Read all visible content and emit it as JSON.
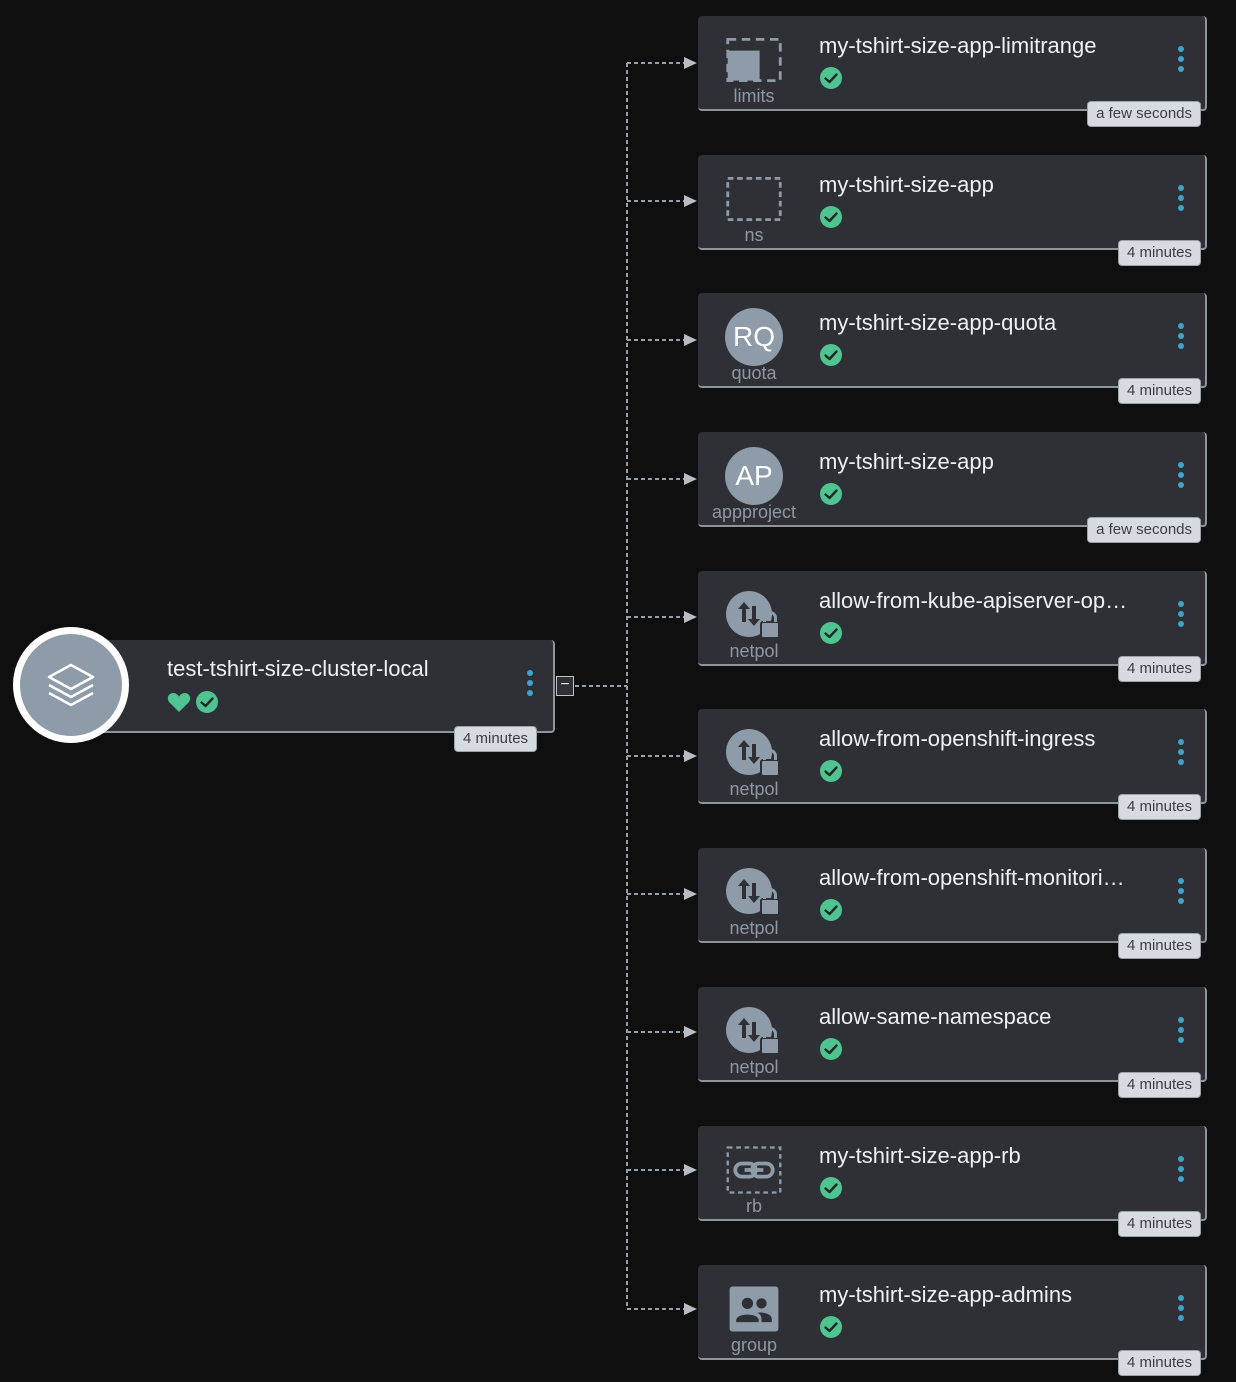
{
  "colors": {
    "background": "#0f0f10",
    "node_bg": "#2f3036",
    "accent": "#3fa3cf",
    "healthy": "#4fc490",
    "icon_gray": "#8e9ba8",
    "badge_bg": "#d5dbe1"
  },
  "root": {
    "title": "test-tshirt-size-cluster-local",
    "icon": "layers-icon",
    "status_icons": [
      "heart-icon",
      "check-circle-icon"
    ],
    "age": "4 minutes"
  },
  "children": [
    {
      "title": "my-tshirt-size-app-limitrange",
      "kind": "limits",
      "icon": "limits-icon",
      "age": "a few seconds"
    },
    {
      "title": "my-tshirt-size-app",
      "kind": "ns",
      "icon": "namespace-icon",
      "age": "4 minutes"
    },
    {
      "title": "my-tshirt-size-app-quota",
      "kind": "quota",
      "icon": "RQ",
      "age": "4 minutes"
    },
    {
      "title": "my-tshirt-size-app",
      "kind": "appproject",
      "icon": "AP",
      "age": "a few seconds"
    },
    {
      "title": "allow-from-kube-apiserver-op…",
      "kind": "netpol",
      "icon": "netpol-icon",
      "age": "4 minutes"
    },
    {
      "title": "allow-from-openshift-ingress",
      "kind": "netpol",
      "icon": "netpol-icon",
      "age": "4 minutes"
    },
    {
      "title": "allow-from-openshift-monitori…",
      "kind": "netpol",
      "icon": "netpol-icon",
      "age": "4 minutes"
    },
    {
      "title": "allow-same-namespace",
      "kind": "netpol",
      "icon": "netpol-icon",
      "age": "4 minutes"
    },
    {
      "title": "my-tshirt-size-app-rb",
      "kind": "rb",
      "icon": "link-icon",
      "age": "4 minutes"
    },
    {
      "title": "my-tshirt-size-app-admins",
      "kind": "group",
      "icon": "group-icon",
      "age": "4 minutes"
    }
  ],
  "collapse_label": "−"
}
